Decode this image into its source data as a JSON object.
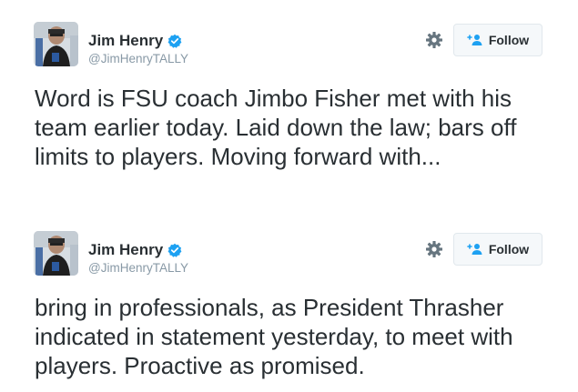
{
  "tweets": [
    {
      "author": {
        "name": "Jim Henry",
        "handle": "@JimHenryTALLY",
        "verified": true
      },
      "follow_label": "Follow",
      "text": "Word is FSU coach Jimbo Fisher met with his team earlier today. Laid down the law; bars off limits to players. Moving forward with..."
    },
    {
      "author": {
        "name": "Jim Henry",
        "handle": "@JimHenryTALLY",
        "verified": true
      },
      "follow_label": "Follow",
      "text": "bring in professionals, as President Thrasher indicated in statement yesterday, to meet with players. Proactive as promised."
    }
  ],
  "icons": {
    "settings": "gear-icon",
    "verified": "verified-badge-icon",
    "follow": "add-user-icon"
  },
  "colors": {
    "verified_blue": "#1da1f2",
    "text": "#292f33",
    "secondary_text": "#8899a6",
    "button_bg": "#f5f8fa",
    "button_border": "#e1e8ed",
    "icon_gray": "#66757f"
  }
}
